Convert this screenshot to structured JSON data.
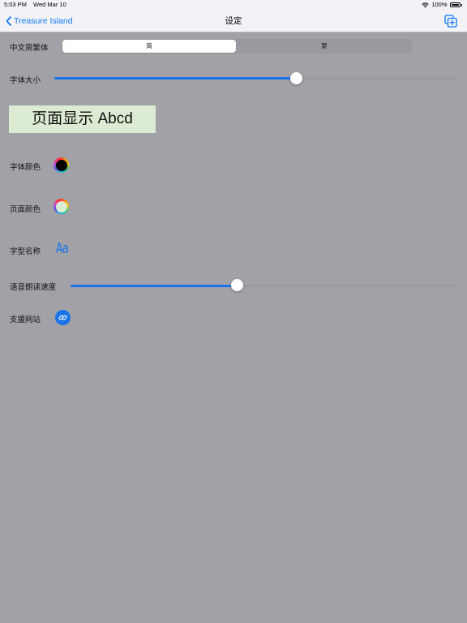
{
  "status_bar": {
    "time": "5:03 PM",
    "date": "Wed Mar 10",
    "battery": "100%",
    "wifi_icon": "wifi-icon",
    "battery_icon": "battery-icon"
  },
  "nav": {
    "back_label": "Treasure Island",
    "title": "设定",
    "back_icon": "chevron-left-icon",
    "action_icon": "add-copy-icon"
  },
  "settings": {
    "chinese_script": {
      "label": "中文简繁体",
      "options": [
        "简",
        "繁"
      ],
      "selected": "简"
    },
    "font_size": {
      "label": "字体大小",
      "value": 0.6
    },
    "preview_text": "页面显示 Abcd",
    "font_color": {
      "label": "字体颜色",
      "color": "#000000"
    },
    "page_color": {
      "label": "页面颜色",
      "color": "#dcebd4"
    },
    "typeface": {
      "label": "字型名称",
      "button": "Aa"
    },
    "speech_speed": {
      "label": "语音朗读速度",
      "value": 0.43
    },
    "support_site": {
      "label": "支援网站",
      "icon": "link-icon"
    }
  },
  "colors": {
    "accent": "#1a73e8",
    "background": "#a2a1a7",
    "bar": "#f2f2f7"
  }
}
